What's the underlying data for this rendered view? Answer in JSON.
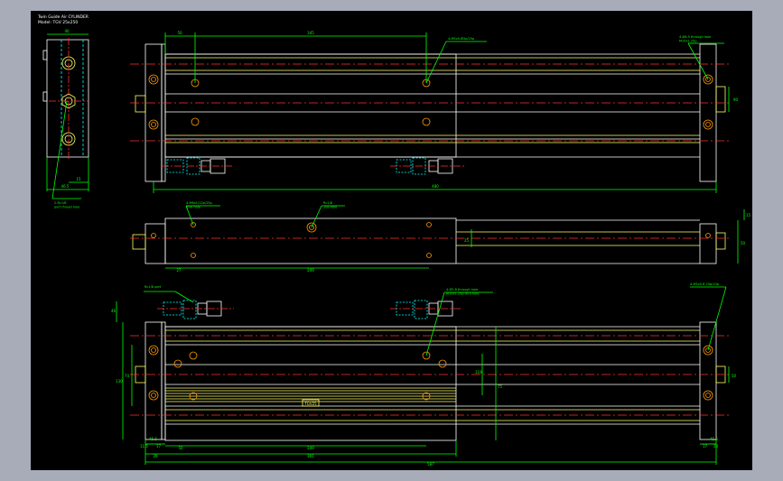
{
  "title_block": {
    "title": "Twin Guide Air CYLINDER",
    "model": "Model: TGV 25x250"
  },
  "colors": {
    "background": "#000000",
    "frame_outer": "#a8acb8",
    "outline": "#ffffff",
    "rod": "#ffff66",
    "dimension": "#00ff00",
    "centerline": "#ff3030",
    "hidden": "#00ffff",
    "hole": "#ff9900"
  },
  "dimensions": {
    "top_50": "50",
    "top_345": "345",
    "top_right_90": "90",
    "top_overall": "480",
    "mid_27": "27",
    "mid_249": "249",
    "mid_15": "15",
    "mid_25": "25",
    "mid_50": "50",
    "bot_50": "50",
    "bot_249": "249",
    "bot_301": "301",
    "bot_587": "587",
    "bot_29": "29",
    "bot_11": "11.5",
    "bot_17": "17",
    "bot_45": "45.5",
    "bot_r_15": "17",
    "bot_r_23": "23",
    "bot_r_45": "45.5",
    "left_46": "46",
    "left_130": "130",
    "left_74": "74",
    "left_119": "119",
    "side_40": "40",
    "side_46": "46.5",
    "side_15": "15",
    "side_75": "75"
  },
  "callouts": {
    "c1": "4-M5x0.8Dp/25p",
    "c2": "4-Ø6.5 through hole\nM10x1.25p",
    "c3": "2-Rc1/8\nport thread hole",
    "c4": "4-M6x1/12p/25p\nthru hole",
    "c5": "Rc1/8\n10p hole",
    "c6": "4-Ø5.8 through hole\nM10x1.25p thru hole",
    "c7": "Rc1/8 port",
    "c8": "4-M5x0.8 25p/10p"
  },
  "label_plate": "TGV25"
}
